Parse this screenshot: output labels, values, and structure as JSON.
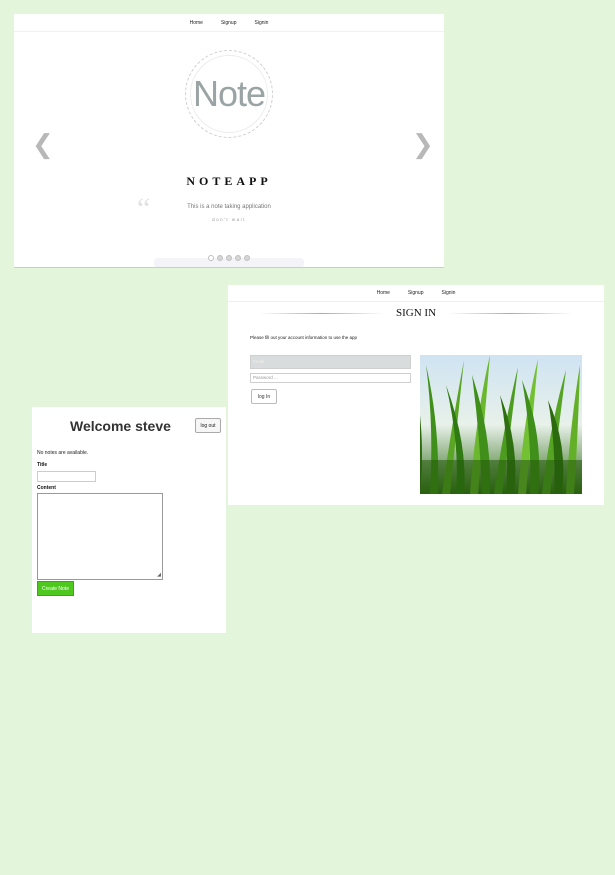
{
  "carousel_page": {
    "nav": [
      "Home",
      "Signup",
      "Signin"
    ],
    "logo_text": "Note",
    "app_name": "NOTEAPP",
    "tagline": "This is a note taking application",
    "subtagline": "don't wait",
    "slide_count": 5,
    "active_slide": 1
  },
  "signin_page": {
    "nav": [
      "Home",
      "Signup",
      "Signin"
    ],
    "title": "SIGN IN",
    "intro": "Please fill out your account information to use the app",
    "email_placeholder": "Email ...",
    "password_placeholder": "Password ...",
    "login_label": "log In"
  },
  "welcome_page": {
    "heading": "Welcome steve",
    "logout_label": "log out",
    "empty_message": "No notes are available.",
    "title_label": "Title",
    "content_label": "Content",
    "create_label": "Create Note"
  },
  "colors": {
    "background": "#e3f5da",
    "create_button": "#4ec81f"
  }
}
